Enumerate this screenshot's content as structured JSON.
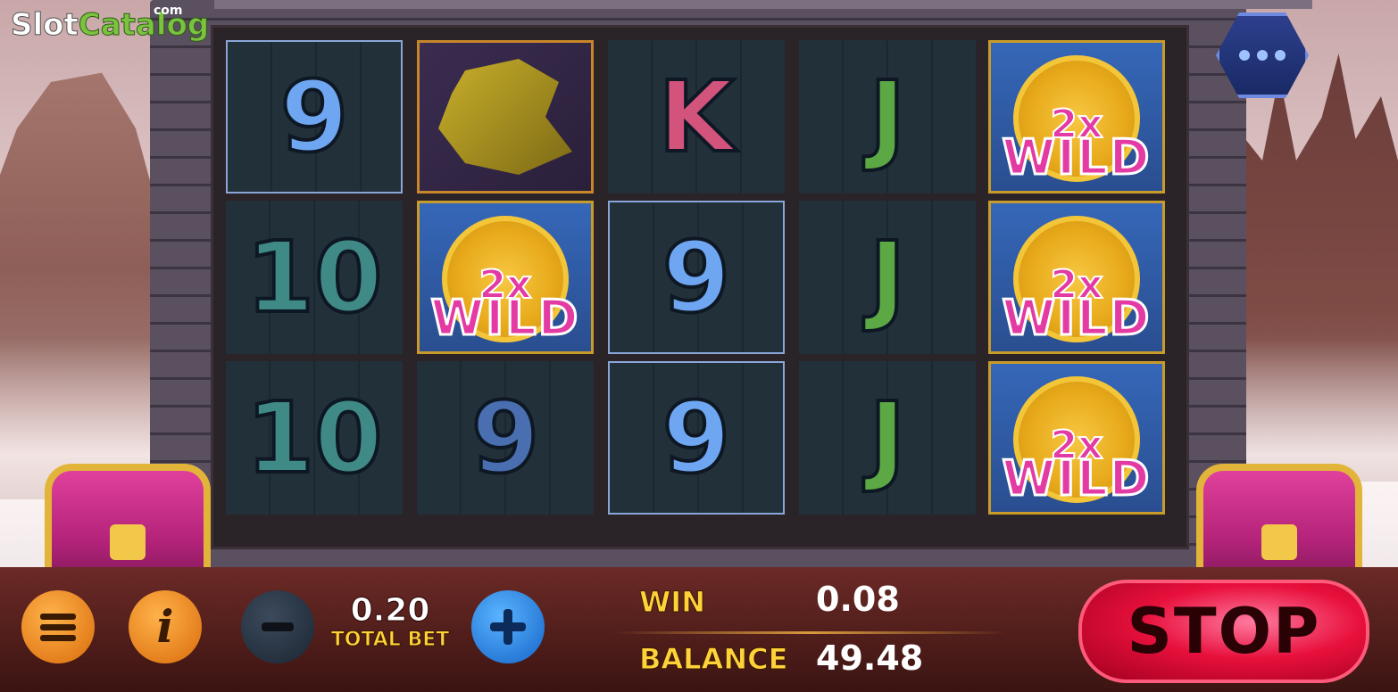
{
  "branding": {
    "logo_slot": "Slot",
    "logo_catalog": "Catalog",
    "logo_com": "com"
  },
  "reels": [
    [
      "9",
      "dragon",
      "K",
      "J",
      "wild"
    ],
    [
      "10",
      "wild",
      "9",
      "J",
      "wild"
    ],
    [
      "10",
      "9",
      "9",
      "J",
      "wild"
    ]
  ],
  "wild": {
    "multiplier": "2x",
    "word": "WILD"
  },
  "bet": {
    "value": "0.20",
    "label": "TOTAL BET"
  },
  "win": {
    "label": "WIN",
    "value": "0.08"
  },
  "balance": {
    "label": "BALANCE",
    "value": "49.48"
  },
  "stop_label": "STOP",
  "colors": {
    "stop": "#e8103c",
    "wild_text": "#e33aa3",
    "label_gold": "#ffd23a"
  }
}
